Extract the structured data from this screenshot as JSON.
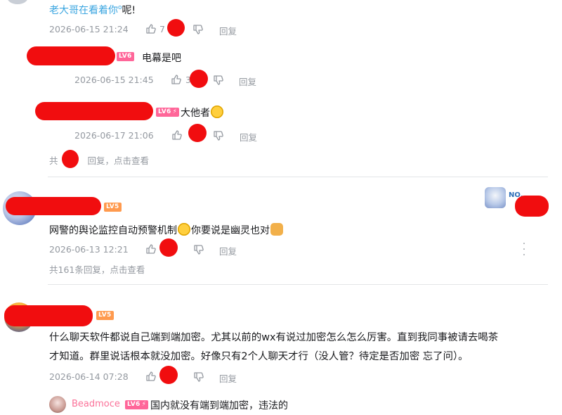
{
  "comments": [
    {
      "id": "reply1",
      "user_link": "老大哥在看着你",
      "text": "呢!",
      "time": "2026-06-15 21:24",
      "likes": "7",
      "reply_label": "回复"
    },
    {
      "id": "reply2",
      "level": "LV6",
      "text": "电幕是吧",
      "time": "2026-06-15 21:45",
      "likes": "3",
      "reply_label": "回复"
    },
    {
      "id": "reply3",
      "level": "LV6",
      "text": "大他者",
      "time": "2026-06-17 21:06",
      "reply_label": "回复"
    }
  ],
  "thread1_footer": {
    "prefix": "共",
    "suffix": "回复，点击查看"
  },
  "comment2": {
    "level": "LV5",
    "text_a": "网警的舆论监控自动预警机制",
    "text_b": "你要说是幽灵也对",
    "time": "2026-06-13 12:21",
    "reply_label": "回复",
    "footer": "共161条回复，点击查看",
    "badge_text": "NO."
  },
  "comment3": {
    "level": "LV5",
    "line1": "什么聊天软件都说自己端到端加密。尤其以前的wx有说过加密怎么怎么厉害。直到我同事被请去喝茶",
    "line2": "才知道。群里说话根本就没加密。好像只有2个人聊天才行（没人管？待定是否加密 忘了问）。",
    "time": "2026-06-14 07:28",
    "reply_label": "回复"
  },
  "sub_reply": {
    "username": "Beadmoce",
    "level": "LV6",
    "text": "国内就没有端到端加密，违法的"
  },
  "colors": {
    "redaction": "#f10d0f",
    "link": "#3aa5e0",
    "meta": "#9499a0",
    "lv6": "#ff6699",
    "lv5": "#ff9a4e"
  },
  "icons": [
    "thumb-up-icon",
    "thumb-down-icon",
    "more-icon",
    "emoji-smile",
    "emoji-doge"
  ]
}
